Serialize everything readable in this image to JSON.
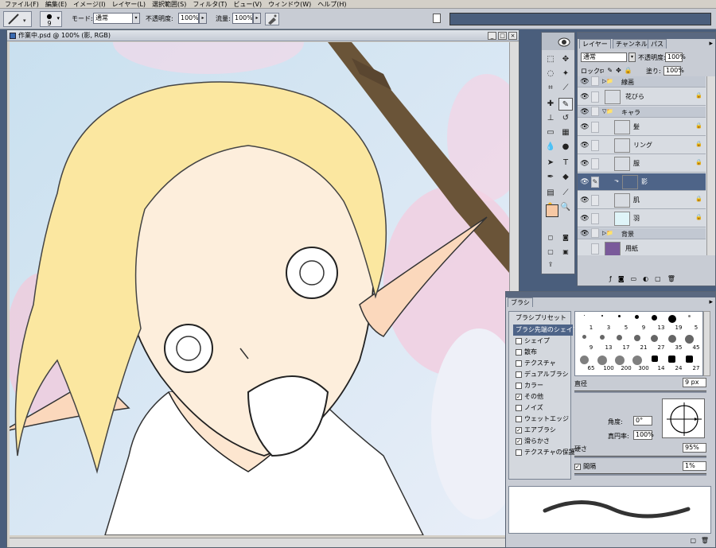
{
  "menu": [
    "ファイル(F)",
    "編集(E)",
    "イメージ(I)",
    "レイヤー(L)",
    "選択範囲(S)",
    "フィルタ(T)",
    "ビュー(V)",
    "ウィンドウ(W)",
    "ヘルプ(H)"
  ],
  "options": {
    "brush_size": "9",
    "mode_label": "モード:",
    "mode_value": "通常",
    "opacity_label": "不透明度:",
    "opacity_value": "100%",
    "flow_label": "流量:",
    "flow_value": "100%"
  },
  "document": {
    "title": "作業中.psd @ 100% (影, RGB)"
  },
  "layers_panel": {
    "tabs": [
      "レイヤー",
      "チャンネル",
      "パス"
    ],
    "blend_mode": "通常",
    "opacity_label": "不透明度:",
    "opacity_value": "100%",
    "lock_label": "ロック:",
    "fill_label": "塗り:",
    "fill_value": "100%",
    "layers": [
      {
        "name": "線画",
        "type": "group"
      },
      {
        "name": "花びら",
        "type": "layer"
      },
      {
        "name": "キャラ",
        "type": "group-open"
      },
      {
        "name": "髪",
        "type": "layer"
      },
      {
        "name": "リング",
        "type": "layer"
      },
      {
        "name": "服",
        "type": "layer"
      },
      {
        "name": "影",
        "type": "layer-active"
      },
      {
        "name": "肌",
        "type": "layer"
      },
      {
        "name": "羽",
        "type": "layer"
      },
      {
        "name": "背景",
        "type": "group"
      },
      {
        "name": "用紙",
        "type": "layer"
      }
    ]
  },
  "brush_panel": {
    "tab": "ブラシ",
    "options": [
      {
        "label": "ブラシプリセット",
        "check": "none"
      },
      {
        "label": "ブラシ先端のシェイプ",
        "check": "selected"
      },
      {
        "label": "シェイプ",
        "check": "off"
      },
      {
        "label": "散布",
        "check": "off"
      },
      {
        "label": "テクスチャ",
        "check": "off"
      },
      {
        "label": "デュアルブラシ",
        "check": "off"
      },
      {
        "label": "カラー",
        "check": "off"
      },
      {
        "label": "その他",
        "check": "on"
      },
      {
        "label": "ノイズ",
        "check": "off"
      },
      {
        "label": "ウェットエッジ",
        "check": "off"
      },
      {
        "label": "エアブラシ",
        "check": "on"
      },
      {
        "label": "滑らかさ",
        "check": "on"
      },
      {
        "label": "テクスチャの保護",
        "check": "off"
      }
    ],
    "tips_row1": [
      "1",
      "3",
      "5",
      "9",
      "13",
      "19",
      "5"
    ],
    "tips_row2": [
      "9",
      "13",
      "17",
      "21",
      "27",
      "35",
      "45"
    ],
    "tips_row3": [
      "65",
      "100",
      "200",
      "300",
      "14",
      "24",
      "27"
    ],
    "diameter_label": "直径",
    "diameter_value": "9 px",
    "angle_label": "角度:",
    "angle_value": "0°",
    "roundness_label": "真円率:",
    "roundness_value": "100%",
    "hardness_label": "硬さ",
    "hardness_value": "95%",
    "spacing_label": "間隔",
    "spacing_value": "1%"
  },
  "colors": {
    "foreground": "#f6c8a4",
    "background": "#ffffff",
    "layer_paper": "#7a5a9a"
  }
}
